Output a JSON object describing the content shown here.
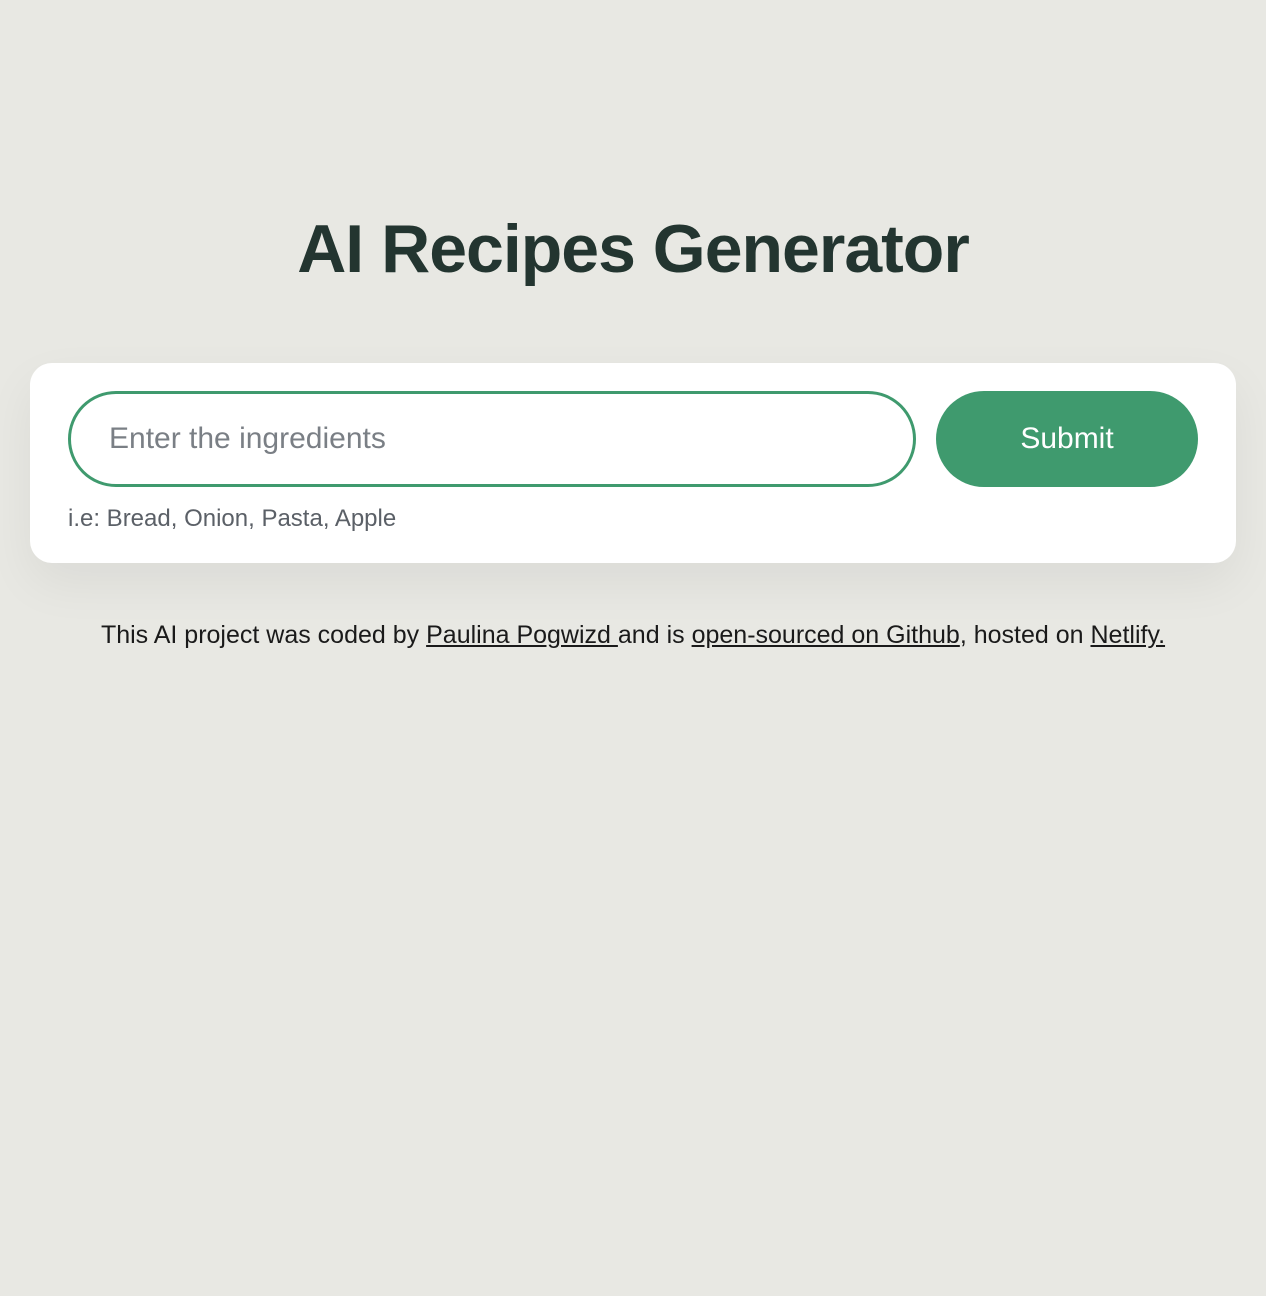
{
  "header": {
    "title": "AI Recipes Generator"
  },
  "form": {
    "input_placeholder": "Enter the ingredients",
    "submit_label": "Submit",
    "hint": "i.e: Bread, Onion, Pasta, Apple"
  },
  "footer": {
    "text_prefix": "This AI project was coded by ",
    "author": "Paulina Pogwizd ",
    "text_mid1": "and is ",
    "github": "open-sourced on Github",
    "text_mid2": ", hosted on ",
    "host": "Netlify."
  }
}
